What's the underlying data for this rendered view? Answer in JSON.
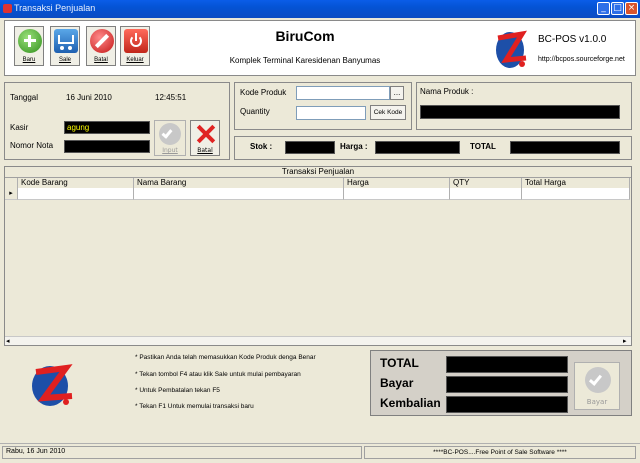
{
  "window": {
    "title": "Transaksi Penjualan"
  },
  "toolbar": {
    "baru_label": "Baru",
    "sale_label": "Sale",
    "batal_label": "Batal",
    "keluar_label": "Keluar"
  },
  "header": {
    "company": "BiruCom",
    "address": "Komplek Terminal Karesidenan Banyumas",
    "product": "BC-POS v1.0.0",
    "url": "http://bcpos.sourceforge.net"
  },
  "info": {
    "tanggal_label": "Tanggal",
    "tanggal_value": "16 Juni 2010",
    "time_value": "12:45:51",
    "kasir_label": "Kasir",
    "kasir_value": "agung",
    "nomor_nota_label": "Nomor Nota",
    "nomor_nota_value": "",
    "input_label": "Input",
    "batal_label": "Batal"
  },
  "product": {
    "kode_produk_label": "Kode Produk",
    "kode_produk_value": "",
    "browse_label": "...",
    "quantity_label": "Quantity",
    "quantity_value": "",
    "cek_kode_label": "Cek Kode",
    "nama_produk_label": "Nama Produk :",
    "stok_label": "Stok :",
    "harga_label": "Harga :",
    "total_label": "TOTAL"
  },
  "grid": {
    "title": "Transaksi Penjualan",
    "columns": [
      "Kode Barang",
      "Nama Barang",
      "Harga",
      "QTY",
      "Total Harga"
    ]
  },
  "notes": [
    "* Pastikan Anda telah memasukkan Kode Produk denga Benar",
    "* Tekan tombol F4 atau klik Sale untuk mulai pembayaran",
    "* Untuk Pembatalan tekan F5",
    "* Tekan F1 Untuk memulai transaksi baru"
  ],
  "payment": {
    "total_label": "TOTAL",
    "bayar_label": "Bayar",
    "kembalian_label": "Kembalian",
    "bayar_button": "Bayar"
  },
  "status": {
    "date": "Rabu, 16 Jun 2010",
    "app": "****BC-POS....Free Point of Sale Software ****"
  },
  "colors": {
    "titlebar": "#0453d4",
    "dark_field": "#000000",
    "window_bg": "#ece9d8"
  }
}
